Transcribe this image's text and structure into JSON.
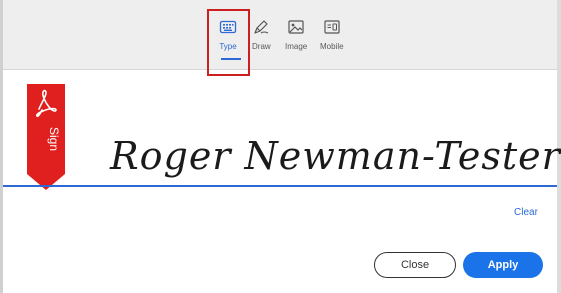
{
  "toolbar": {
    "tabs": [
      {
        "label": "Type",
        "icon": "keyboard-icon",
        "selected": true
      },
      {
        "label": "Draw",
        "icon": "pen-icon",
        "selected": false
      },
      {
        "label": "Image",
        "icon": "image-icon",
        "selected": false
      },
      {
        "label": "Mobile",
        "icon": "mobile-icon",
        "selected": false
      }
    ]
  },
  "sign_badge": {
    "label": "Sign",
    "icon": "acrobat-icon"
  },
  "signature": {
    "text": "Roger Newman-Tester"
  },
  "actions": {
    "clear_label": "Clear",
    "close_label": "Close",
    "apply_label": "Apply"
  },
  "colors": {
    "accent": "#1a73e8",
    "highlight_box": "#cc1f1f",
    "badge": "#e0201e"
  }
}
